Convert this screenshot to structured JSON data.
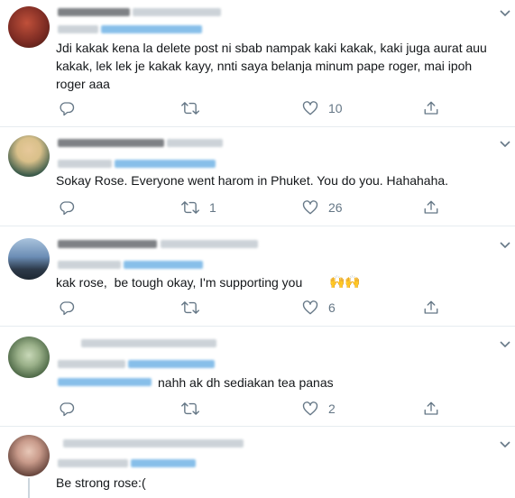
{
  "tweets": [
    {
      "id": "t1",
      "text_lines": [
        "Jdi kakak kena la delete post ni sbab nampak kaki kakak, kaki juga aurat auu",
        "kakak, lek lek je kakak kayy, nnti saya belanja minum pape roger, mai ipoh",
        "roger aaa"
      ],
      "reply_count": "",
      "retweet_count": "",
      "like_count": "10",
      "avatar_colors": [
        "#7a2a22",
        "#c0503a"
      ]
    },
    {
      "id": "t2",
      "text_lines": [
        "Sokay Rose. Everyone went harom in Phuket. You do you. Hahahaha."
      ],
      "reply_count": "",
      "retweet_count": "1",
      "like_count": "26",
      "avatar_colors": [
        "#d9c08a",
        "#3c5b4a"
      ]
    },
    {
      "id": "t3",
      "text_lines": [
        "kak rose,  be tough okay, I'm supporting you "
      ],
      "emoji": "🙌🙌",
      "reply_count": "",
      "retweet_count": "",
      "like_count": "6",
      "avatar_colors": [
        "#6b8db5",
        "#2d3a4a"
      ]
    },
    {
      "id": "t4",
      "text_lines": [
        "nahh ak dh sediakan tea panas"
      ],
      "reply_count": "",
      "retweet_count": "",
      "like_count": "2",
      "avatar_colors": [
        "#9ab089",
        "#3f5b3a"
      ]
    },
    {
      "id": "t5",
      "text_lines": [
        "Be strong rose:("
      ],
      "reply_count": "",
      "retweet_count": "",
      "like_count": "",
      "avatar_colors": [
        "#c89a8a",
        "#5a3a32"
      ]
    }
  ],
  "colors": {
    "text": "#14171a",
    "secondary": "#657786",
    "divider": "#e6ecf0",
    "mention": "#1da1f2"
  }
}
